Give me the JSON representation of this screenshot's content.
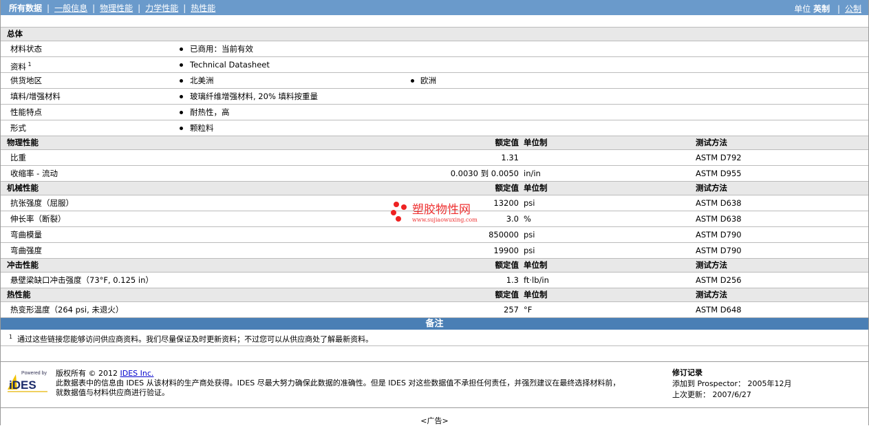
{
  "nav": {
    "items": [
      "所有数据",
      "一般信息",
      "物理性能",
      "力学性能",
      "热性能"
    ],
    "unit_label": "单位",
    "unit_en": "英制",
    "unit_metric": "公制"
  },
  "general": {
    "title": "总体",
    "rows": [
      {
        "label": "材料状态",
        "v1": "已商用：当前有效"
      },
      {
        "label": "资料",
        "sup": "1",
        "v1": "Technical Datasheet",
        "link": true
      },
      {
        "label": "供货地区",
        "v1": "北美洲",
        "v2": "欧洲"
      },
      {
        "label": "填料/增强材料",
        "v1": "玻璃纤维增强材料, 20% 填料按重量"
      },
      {
        "label": "性能特点",
        "v1": "耐热性，高"
      },
      {
        "label": "形式",
        "v1": "颗粒料"
      }
    ]
  },
  "sections": [
    {
      "title": "物理性能",
      "h_val": "额定值",
      "h_unit": "单位制",
      "h_method": "测试方法",
      "rows": [
        {
          "label": "比重",
          "value": "1.31",
          "unit": "",
          "method": "ASTM D792"
        },
        {
          "label": "收缩率  - 流动",
          "value": "0.0030 到  0.0050",
          "unit": "in/in",
          "method": "ASTM D955"
        }
      ]
    },
    {
      "title": "机械性能",
      "h_val": "额定值",
      "h_unit": "单位制",
      "h_method": "测试方法",
      "rows": [
        {
          "label": "抗张强度（屈服）",
          "value": "13200",
          "unit": "psi",
          "method": "ASTM D638"
        },
        {
          "label": "伸长率（断裂）",
          "value": "3.0",
          "unit": "%",
          "method": "ASTM D638"
        },
        {
          "label": "弯曲模量",
          "value": "850000",
          "unit": "psi",
          "method": "ASTM D790"
        },
        {
          "label": "弯曲强度",
          "value": "19900",
          "unit": "psi",
          "method": "ASTM D790"
        }
      ]
    },
    {
      "title": "冲击性能",
      "h_val": "额定值",
      "h_unit": "单位制",
      "h_method": "测试方法",
      "rows": [
        {
          "label": "悬壁梁缺口冲击强度（73°F, 0.125 in）",
          "value": "1.3",
          "unit": "ft·lb/in",
          "method": "ASTM D256"
        }
      ]
    },
    {
      "title": "热性能",
      "h_val": "额定值",
      "h_unit": "单位制",
      "h_method": "测试方法",
      "rows": [
        {
          "label": "热变形温度（264 psi, 未退火）",
          "value": "257",
          "unit": "°F",
          "method": "ASTM D648"
        }
      ]
    }
  ],
  "notes": {
    "title": "备注",
    "sup": "1",
    "text": "通过这些链接您能够访问供应商资料。我们尽量保证及时更新资料；不过您可以从供应商处了解最新资料。"
  },
  "footer": {
    "logo_powered": "Powered by",
    "logo_text": "IDES",
    "copyright": "版权所有  © 2012 ",
    "company": "IDES Inc.",
    "disclaimer1": "此数据表中的信息由 IDES 从该材料的生产商处获得。IDES 尽最大努力确保此数据的准确性。但是 IDES 对这些数据值不承担任何责任，并强烈建议在最终选择材料前，",
    "disclaimer2": "就数据值与材料供应商进行验证。",
    "rev_title": "修订记录",
    "rev_added": "添加到  Prospector：  2005年12月",
    "rev_updated": "上次更新：    2007/6/27"
  },
  "watermark": {
    "name": "塑胶物性网",
    "url": "www.sujiaowuxing.com"
  },
  "ad": "<广告>"
}
